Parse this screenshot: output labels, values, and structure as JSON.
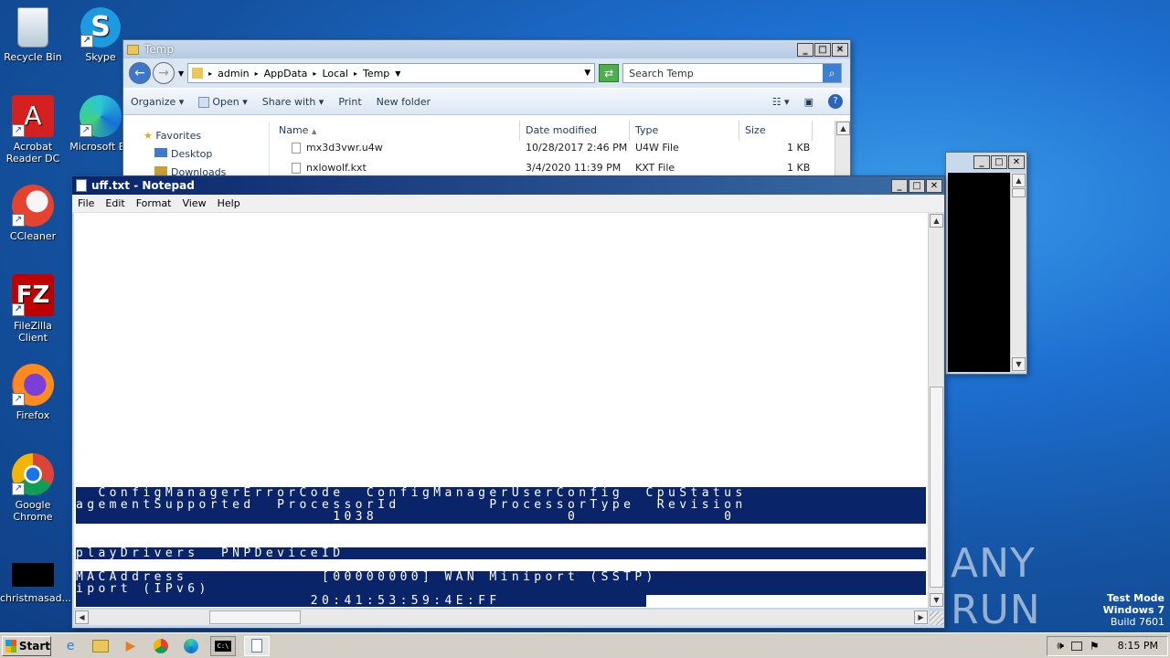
{
  "desktop": {
    "icons": [
      {
        "label": "Recycle Bin"
      },
      {
        "label": "Skype"
      },
      {
        "label": "Acrobat Reader DC"
      },
      {
        "label": "Microsoft Ed"
      },
      {
        "label": "CCleaner"
      },
      {
        "label": "FileZilla Client"
      },
      {
        "label": "Firefox"
      },
      {
        "label": "Google Chrome"
      },
      {
        "label": "christmasad..."
      }
    ],
    "watermark": {
      "text": "ANY RUN"
    },
    "test_mode": {
      "line1": "Test Mode",
      "line2": "Windows 7",
      "line3": "Build 7601"
    }
  },
  "explorer": {
    "title": "Temp",
    "breadcrumb": [
      "admin",
      "AppData",
      "Local",
      "Temp"
    ],
    "search_placeholder": "Search Temp",
    "toolbar": {
      "organize": "Organize",
      "open": "Open",
      "share_with": "Share with",
      "print": "Print",
      "new_folder": "New folder"
    },
    "nav": {
      "favorites": "Favorites",
      "desktop": "Desktop",
      "downloads": "Downloads"
    },
    "columns": {
      "name": "Name",
      "date": "Date modified",
      "type": "Type",
      "size": "Size"
    },
    "files": [
      {
        "name": "mx3d3vwr.u4w",
        "date": "10/28/2017 2:46 PM",
        "type": "U4W File",
        "size": "1 KB"
      },
      {
        "name": "nxlowolf.kxt",
        "date": "3/4/2020 11:39 PM",
        "type": "KXT File",
        "size": "1 KB"
      }
    ]
  },
  "notepad": {
    "title": "uff.txt - Notepad",
    "menu": {
      "file": "File",
      "edit": "Edit",
      "format": "Format",
      "view": "View",
      "help": "Help"
    },
    "lines": [
      "  ConfigManagerErrorCode  ConfigManagerUserConfig  CpuStatus",
      "agementSupported  ProcessorId        ProcessorType  Revision",
      "                       1038                 0             0",
      "playDrivers  PNPDeviceID",
      "MACAddress            [00000000] WAN Miniport (SSTP)",
      "iport (IPv6)",
      "                     20:41:53:59:4E:FF"
    ]
  },
  "taskbar": {
    "start_label": "Start",
    "clock": "8:15 PM"
  }
}
